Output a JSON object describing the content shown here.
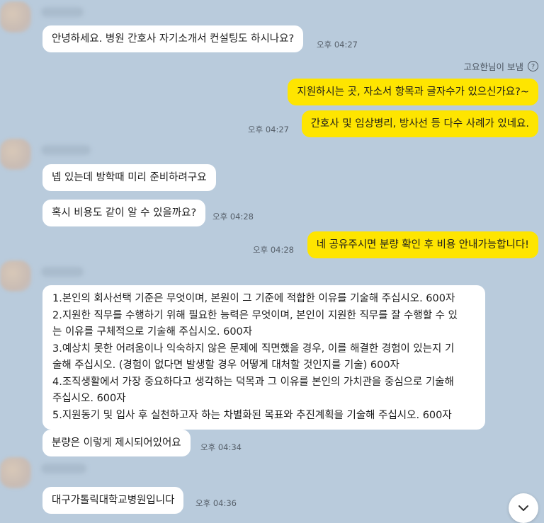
{
  "read_status": {
    "label": "고요한님이 보냄",
    "help_glyph": "?"
  },
  "messages": [
    {
      "text": "안녕하세요. 병원 간호사 자기소개서 컨설팅도 하시나요?",
      "time": "오후 04:27"
    },
    {
      "text": "지원하시는 곳, 자소서 항목과 글자수가 있으신가요?~"
    },
    {
      "text": "간호사 및 임상병리, 방사선 등 다수 사례가 있네요.",
      "time": "오후 04:27"
    },
    {
      "text": "넵 있는데 방학때 미리 준비하려구요"
    },
    {
      "text": "혹시 비용도 같이 알 수 있을까요?",
      "time": "오후 04:28"
    },
    {
      "text": "네 공유주시면 분량 확인 후 비용 안내가능합니다!",
      "time": "오후 04:28"
    },
    {
      "lines": [
        "1.본인의 회사선택 기준은 무엇이며, 본원이 그 기준에 적합한 이유를 기술해 주십시오. 600자",
        "2.지원한 직무를 수행하기 위해 필요한 능력은 무엇이며, 본인이 지원한 직무를 잘 수행할 수 있",
        "는 이유를 구체적으로 기술해 주십시오. 600자",
        "3.예상치 못한 어려움이나 익숙하지 않은 문제에 직면했을 경우, 이를 해결한 경험이 있는지 기",
        "술해 주십시오. (경험이 없다면 발생할 경우 어떻게 대처할 것인지를 기술) 600자",
        "4.조직생활에서 가장 중요하다고 생각하는 덕목과 그 이유를 본인의 가치관을 중심으로 기술해",
        "주십시오. 600자",
        "5.지원동기 및 입사 후 실천하고자 하는 차별화된 목표와 추진계획을 기술해 주십시오. 600자"
      ]
    },
    {
      "text": "분량은 이렇게 제시되어있어요",
      "time": "오후 04:34"
    },
    {
      "text": "대구가톨릭대학교병원입니다",
      "time": "오후 04:36"
    }
  ],
  "icons": {
    "scroll_down": "chevron-down-icon",
    "help": "question-circle-icon"
  }
}
